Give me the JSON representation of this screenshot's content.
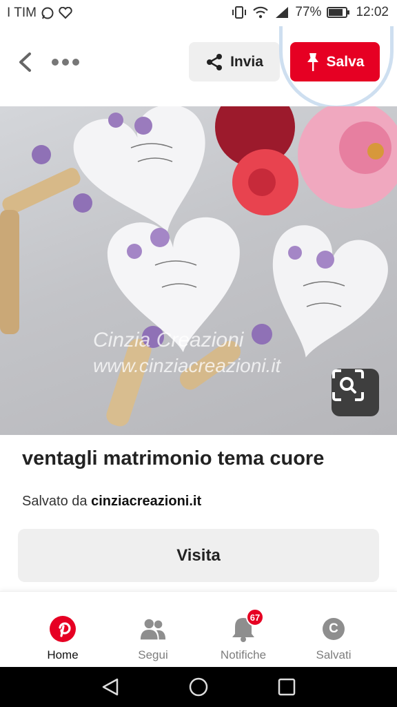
{
  "status_bar": {
    "carrier": "I TIM",
    "battery": "77%",
    "time": "12:02",
    "icons": [
      "whatsapp-icon",
      "heart-icon",
      "vibrate-icon",
      "wifi-icon",
      "signal-icon",
      "battery-icon"
    ]
  },
  "top_bar": {
    "share_label": "Invia",
    "save_label": "Salva",
    "accent": "#e60023"
  },
  "image": {
    "watermark_line1": "Cinzia Creazioni",
    "watermark_line2": "www.cinziacreazioni.it"
  },
  "pin": {
    "title": "ventagli matrimonio tema cuore",
    "saved_prefix": "Salvato da ",
    "source": "cinziacreazioni.it",
    "visit_label": "Visita"
  },
  "bottom_nav": {
    "items": [
      {
        "label": "Home",
        "icon": "pinterest-logo-icon",
        "active": true
      },
      {
        "label": "Segui",
        "icon": "people-icon"
      },
      {
        "label": "Notifiche",
        "icon": "bell-icon",
        "badge": "67"
      },
      {
        "label": "Salvati",
        "icon": "profile-avatar",
        "initial": "C"
      }
    ]
  }
}
